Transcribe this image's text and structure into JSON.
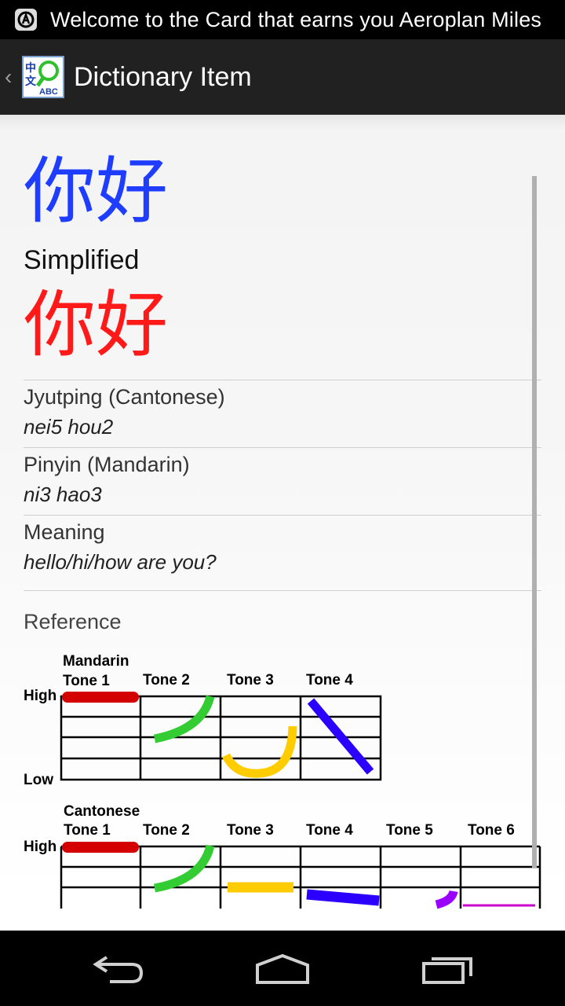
{
  "status_bar": {
    "notification_text": "Welcome to the Card that earns you Aeroplan Miles",
    "notification_icon": "app-notification-icon"
  },
  "action_bar": {
    "title": "Dictionary Item",
    "app_icon": "chinese-dictionary-icon"
  },
  "entry": {
    "traditional": "你好",
    "simplified_label": "Simplified",
    "simplified": "你好",
    "fields": [
      {
        "label": "Jyutping (Cantonese)",
        "value": "nei5 hou2"
      },
      {
        "label": "Pinyin (Mandarin)",
        "value": "ni3 hao3"
      },
      {
        "label": "Meaning",
        "value": "hello/hi/how are you?"
      }
    ],
    "colors": {
      "traditional": "#1f3dff",
      "simplified": "#ff1a1a"
    }
  },
  "reference": {
    "label": "Reference",
    "mandarin": {
      "title": "Mandarin",
      "tones": [
        "Tone 1",
        "Tone 2",
        "Tone 3",
        "Tone 4"
      ],
      "high": "High",
      "low": "Low"
    },
    "cantonese": {
      "title": "Cantonese",
      "tones": [
        "Tone 1",
        "Tone 2",
        "Tone 3",
        "Tone 4",
        "Tone 5",
        "Tone 6"
      ],
      "high": "High"
    },
    "tone_colors": [
      "#d40000",
      "#33cc33",
      "#ffcc00",
      "#2b00ff",
      "#9900ff",
      "#cc00cc"
    ]
  },
  "nav_bar": {
    "back": "back-icon",
    "home": "home-icon",
    "recents": "recents-icon"
  }
}
